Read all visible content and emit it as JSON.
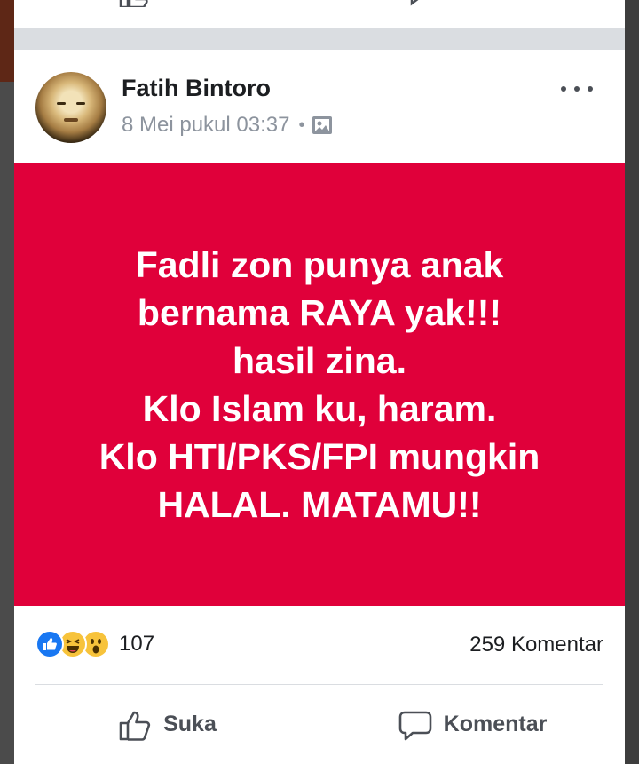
{
  "post": {
    "author": "Fatih Bintoro",
    "timestamp": "8 Mei pukul 03:37",
    "separator": "•",
    "audience_icon": "photo-icon",
    "more_icon": "more-dots-icon",
    "background_color": "#e0003a",
    "text": "Fadli zon punya anak\nbernama RAYA yak!!!\nhasil zina.\nKlo Islam ku, haram.\nKlo HTI/PKS/FPI mungkin\nHALAL.  MATAMU!!"
  },
  "stats": {
    "reaction_icons": [
      "like-reaction-icon",
      "haha-reaction-icon",
      "wow-reaction-icon"
    ],
    "reaction_count": "107",
    "comment_count": "259 Komentar"
  },
  "actions": {
    "like_label": "Suka",
    "like_icon": "thumbs-up-icon",
    "comment_label": "Komentar",
    "comment_icon": "comment-bubble-icon"
  },
  "colors": {
    "accent": "#1877f2",
    "text_primary": "#1c1e21",
    "text_secondary": "#8d949e"
  }
}
